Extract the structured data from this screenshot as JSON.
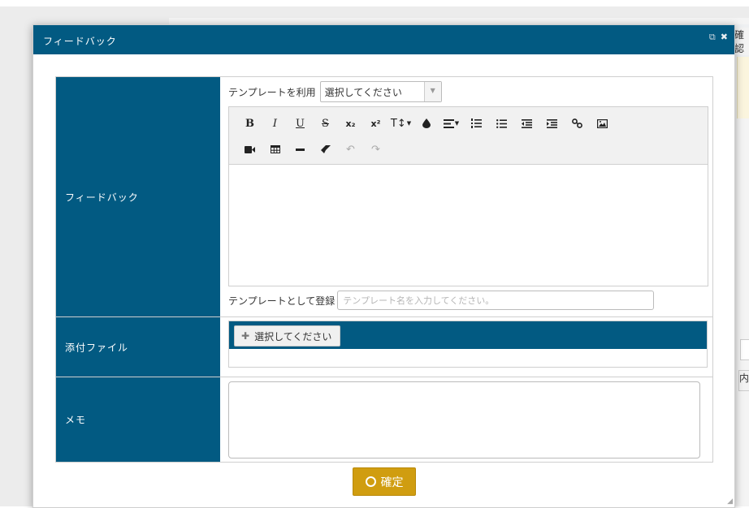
{
  "background": {
    "fragment_top_right": "確認",
    "fragment_mid_right": "内"
  },
  "modal": {
    "title": "フィードバック",
    "header_icons": [
      "external-link-icon",
      "close-icon"
    ]
  },
  "feedback_row": {
    "label": "フィードバック",
    "template_label": "テンプレートを利用",
    "template_select_value": "選択してください",
    "register_label": "テンプレートとして登録",
    "register_placeholder": "テンプレート名を入力してください。"
  },
  "toolbar": {
    "row1": [
      {
        "name": "bold-button",
        "label": "B"
      },
      {
        "name": "italic-button",
        "label": "I"
      },
      {
        "name": "underline-button",
        "label": "U"
      },
      {
        "name": "strikethrough-button",
        "label": "S"
      },
      {
        "name": "subscript-button",
        "label": "x₂"
      },
      {
        "name": "superscript-button",
        "label": "x²"
      },
      {
        "name": "font-size-button",
        "label": "T↕"
      },
      {
        "name": "color-button",
        "icon": "droplet-icon"
      },
      {
        "name": "align-button",
        "icon": "align-left-icon"
      },
      {
        "name": "ordered-list-button",
        "icon": "ordered-list-icon"
      },
      {
        "name": "unordered-list-button",
        "icon": "unordered-list-icon"
      },
      {
        "name": "outdent-button",
        "icon": "outdent-icon"
      },
      {
        "name": "indent-button",
        "icon": "indent-icon"
      },
      {
        "name": "link-button",
        "icon": "link-icon"
      },
      {
        "name": "image-button",
        "icon": "image-icon"
      }
    ],
    "row2": [
      {
        "name": "video-button",
        "icon": "video-icon"
      },
      {
        "name": "table-button",
        "icon": "table-icon"
      },
      {
        "name": "horizontal-rule-button",
        "icon": "minus-icon"
      },
      {
        "name": "eraser-button",
        "icon": "eraser-icon"
      },
      {
        "name": "undo-button",
        "icon": "undo-icon"
      },
      {
        "name": "redo-button",
        "icon": "redo-icon"
      }
    ]
  },
  "attachment_row": {
    "label": "添付ファイル",
    "select_button": "選択してください"
  },
  "memo_row": {
    "label": "メモ"
  },
  "confirm_button": {
    "label": "確定"
  },
  "colors": {
    "header_blue": "#025a82",
    "confirm_gold": "#d09d10"
  }
}
